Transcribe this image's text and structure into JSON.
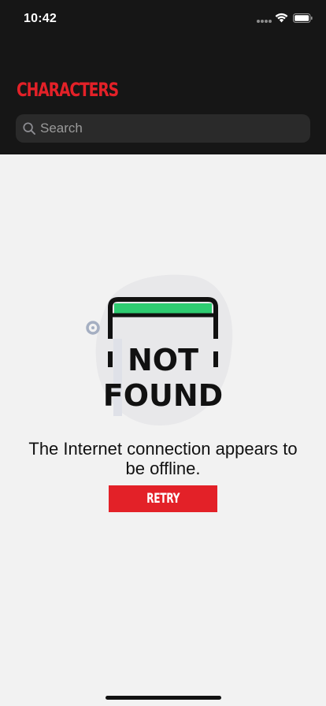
{
  "status_bar": {
    "time": "10:42",
    "icons": [
      "signal-dots-icon",
      "wifi-icon",
      "battery-icon"
    ]
  },
  "header": {
    "title": "CHARACTERS",
    "search": {
      "placeholder": "Search",
      "value": "",
      "icon": "search-icon"
    }
  },
  "error_state": {
    "illustration": {
      "icon": "not-found-illustration",
      "line1": "NOT",
      "line2": "FOUND"
    },
    "message": "The Internet connection appears to be offline.",
    "retry_label": "RETRY"
  },
  "colors": {
    "header_background": "#161616",
    "page_background": "#f2f2f2",
    "accent_red": "#e32128",
    "illustration_green": "#2ecc71",
    "search_field": "#2a2a2a"
  }
}
